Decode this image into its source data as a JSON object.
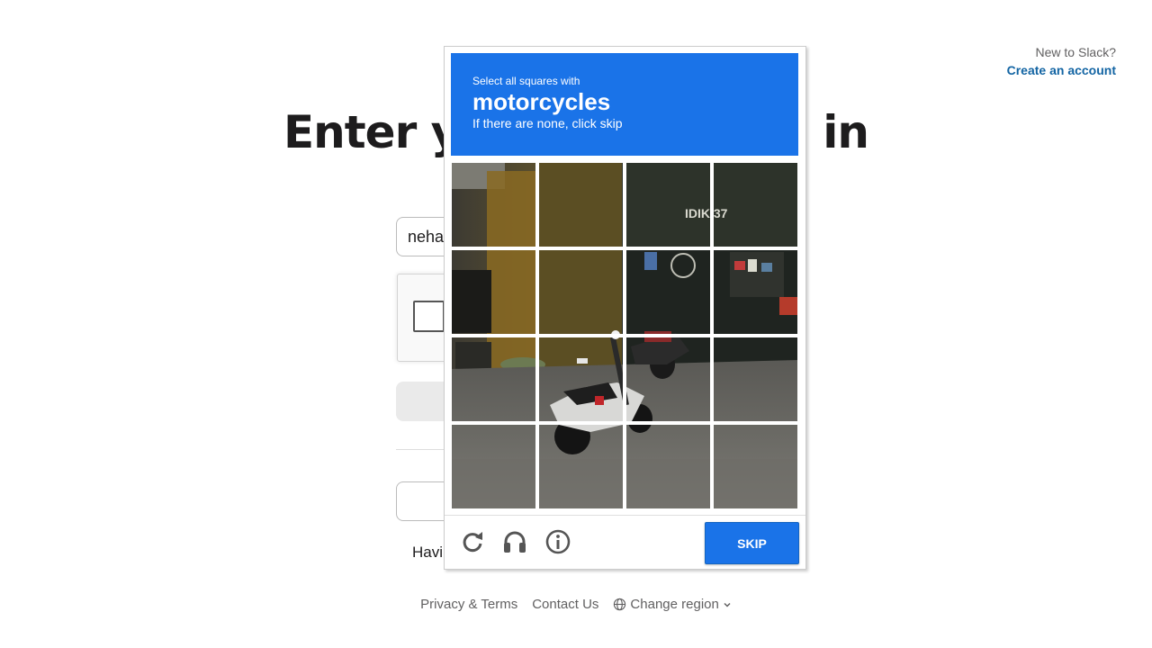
{
  "header": {
    "new_prompt": "New to Slack?",
    "create_account": "Create an account"
  },
  "main": {
    "title_left": "Enter y",
    "title_right": "in",
    "email_value": "nehar",
    "trouble_text": "Havi"
  },
  "footer": {
    "privacy": "Privacy & Terms",
    "contact": "Contact Us",
    "region": "Change region",
    "region_icon": "globe-icon",
    "chevron_icon": "chevron-down-icon"
  },
  "captcha": {
    "instruction": "Select all squares with",
    "target": "motorcycles",
    "hint": "If there are none, click skip",
    "skip_label": "SKIP",
    "header_color": "#1a73e8",
    "icons": [
      "reload-icon",
      "audio-icon",
      "info-icon"
    ],
    "scene_sign_text": "IDIK 37",
    "grid_rows": 4,
    "grid_cols": 4
  }
}
